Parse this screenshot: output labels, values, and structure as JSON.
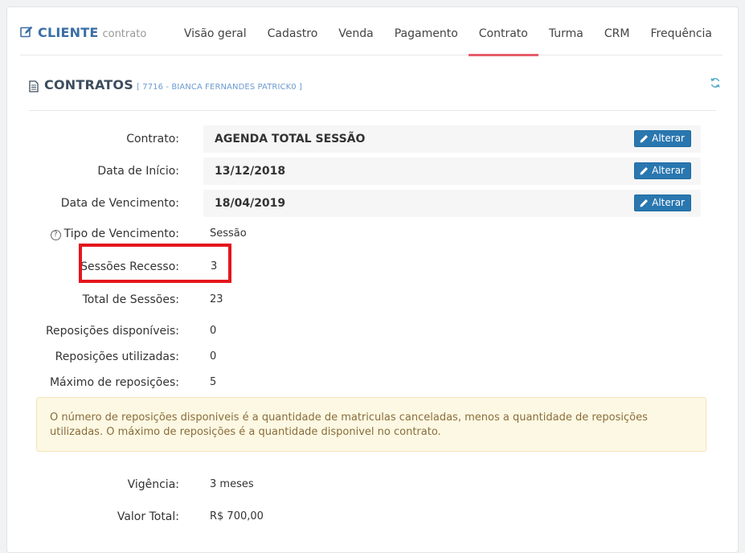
{
  "header": {
    "title": "CLIENTE",
    "subtitle": "contrato",
    "icon": "edit-icon",
    "accent_color": "#3a6ea5"
  },
  "tabs": [
    {
      "label": "Visão geral",
      "active": false
    },
    {
      "label": "Cadastro",
      "active": false
    },
    {
      "label": "Venda",
      "active": false
    },
    {
      "label": "Pagamento",
      "active": false
    },
    {
      "label": "Contrato",
      "active": true
    },
    {
      "label": "Turma",
      "active": false
    },
    {
      "label": "CRM",
      "active": false
    },
    {
      "label": "Frequência",
      "active": false
    }
  ],
  "section": {
    "title": "CONTRATOS",
    "subtitle": "[ 7716 - BIANCA FERNANDES PATRICK0 ]",
    "icon": "document-icon",
    "refresh_icon": "refresh-icon"
  },
  "fields": {
    "contrato": {
      "label": "Contrato:",
      "value": "AGENDA TOTAL SESSÃO",
      "button": "Alterar"
    },
    "data_inicio": {
      "label": "Data de Início:",
      "value": "13/12/2018",
      "button": "Alterar"
    },
    "data_vencimento": {
      "label": "Data de Vencimento:",
      "value": "18/04/2019",
      "button": "Alterar"
    },
    "tipo_vencimento": {
      "label": "Tipo de Vencimento:",
      "value": "Sessão",
      "help": "?"
    },
    "sessoes_recesso": {
      "label": "Sessões Recesso:",
      "value": "3"
    },
    "total_sessoes": {
      "label": "Total de Sessões:",
      "value": "23"
    },
    "reposicoes_disponiveis": {
      "label": "Reposições disponíveis:",
      "value": "0"
    },
    "reposicoes_utilizadas": {
      "label": "Reposições utilizadas:",
      "value": "0"
    },
    "maximo_reposicoes": {
      "label": "Máximo de reposições:",
      "value": "5"
    },
    "vigencia": {
      "label": "Vigência:",
      "value": "3 meses"
    },
    "valor_total": {
      "label": "Valor Total:",
      "value": "R$ 700,00"
    }
  },
  "alert": {
    "text": "O número de reposições disponiveis é a quantidade de matriculas canceladas, menos a quantidade de reposições utilizadas. O máximo de reposições é a quantidade disponivel no contrato."
  },
  "colors": {
    "button": "#2a77b0",
    "active_tab_underline": "#e85d6b",
    "highlight_box": "#e4161c",
    "alert_bg": "#fcf8e3",
    "alert_text": "#8a6d3b"
  }
}
